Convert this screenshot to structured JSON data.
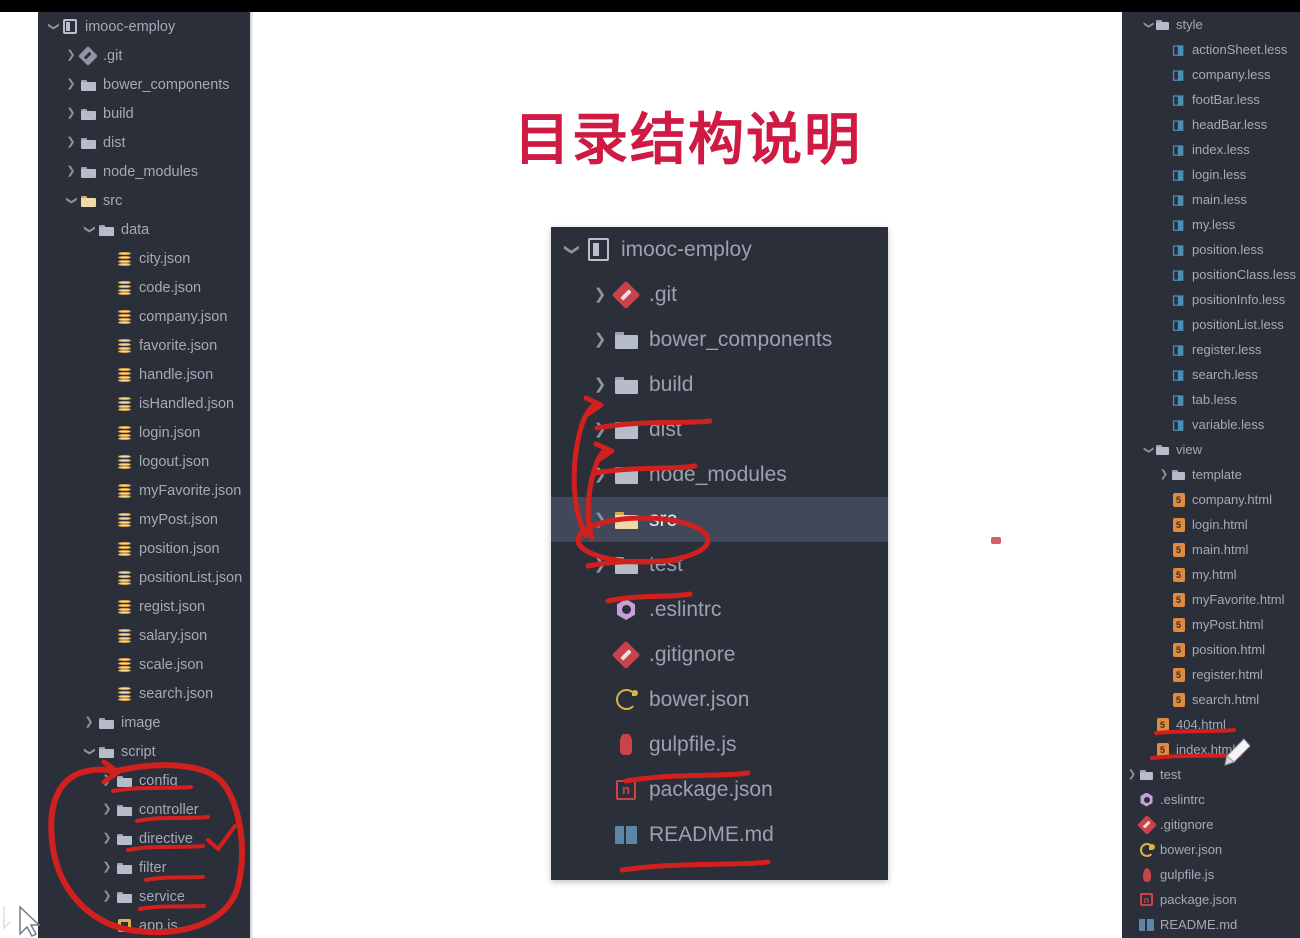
{
  "title": "目录结构说明",
  "colors": {
    "title_red": "#cf1b43",
    "annotation_red": "#d0211f",
    "panel_bg": "#2b2f3a",
    "selected_row": "#41485a",
    "text": "#a4aab5"
  },
  "left_tree": {
    "name": "project-file-tree-left",
    "items": [
      {
        "label": "imooc-employ",
        "indent": 0,
        "arrow": "down",
        "icon": "module-icon"
      },
      {
        "label": ".git",
        "indent": 1,
        "arrow": "right",
        "icon": "git-icon-grey"
      },
      {
        "label": "bower_components",
        "indent": 1,
        "arrow": "right",
        "icon": "folder-icon"
      },
      {
        "label": "build",
        "indent": 1,
        "arrow": "right",
        "icon": "folder-icon"
      },
      {
        "label": "dist",
        "indent": 1,
        "arrow": "right",
        "icon": "folder-icon"
      },
      {
        "label": "node_modules",
        "indent": 1,
        "arrow": "right",
        "icon": "folder-icon"
      },
      {
        "label": "src",
        "indent": 1,
        "arrow": "down",
        "icon": "folder-icon-gold"
      },
      {
        "label": "data",
        "indent": 2,
        "arrow": "down",
        "icon": "folder-icon"
      },
      {
        "label": "city.json",
        "indent": 3,
        "arrow": "none",
        "icon": "json-icon"
      },
      {
        "label": "code.json",
        "indent": 3,
        "arrow": "none",
        "icon": "json-icon"
      },
      {
        "label": "company.json",
        "indent": 3,
        "arrow": "none",
        "icon": "json-icon"
      },
      {
        "label": "favorite.json",
        "indent": 3,
        "arrow": "none",
        "icon": "json-icon"
      },
      {
        "label": "handle.json",
        "indent": 3,
        "arrow": "none",
        "icon": "json-icon"
      },
      {
        "label": "isHandled.json",
        "indent": 3,
        "arrow": "none",
        "icon": "json-icon"
      },
      {
        "label": "login.json",
        "indent": 3,
        "arrow": "none",
        "icon": "json-icon"
      },
      {
        "label": "logout.json",
        "indent": 3,
        "arrow": "none",
        "icon": "json-icon"
      },
      {
        "label": "myFavorite.json",
        "indent": 3,
        "arrow": "none",
        "icon": "json-icon"
      },
      {
        "label": "myPost.json",
        "indent": 3,
        "arrow": "none",
        "icon": "json-icon"
      },
      {
        "label": "position.json",
        "indent": 3,
        "arrow": "none",
        "icon": "json-icon"
      },
      {
        "label": "positionList.json",
        "indent": 3,
        "arrow": "none",
        "icon": "json-icon"
      },
      {
        "label": "regist.json",
        "indent": 3,
        "arrow": "none",
        "icon": "json-icon"
      },
      {
        "label": "salary.json",
        "indent": 3,
        "arrow": "none",
        "icon": "json-icon"
      },
      {
        "label": "scale.json",
        "indent": 3,
        "arrow": "none",
        "icon": "json-icon"
      },
      {
        "label": "search.json",
        "indent": 3,
        "arrow": "none",
        "icon": "json-icon"
      },
      {
        "label": "image",
        "indent": 2,
        "arrow": "right",
        "icon": "folder-icon"
      },
      {
        "label": "script",
        "indent": 2,
        "arrow": "down",
        "icon": "folder-icon"
      },
      {
        "label": "config",
        "indent": 3,
        "arrow": "right",
        "icon": "folder-icon"
      },
      {
        "label": "controller",
        "indent": 3,
        "arrow": "right",
        "icon": "folder-icon"
      },
      {
        "label": "directive",
        "indent": 3,
        "arrow": "right",
        "icon": "folder-icon"
      },
      {
        "label": "filter",
        "indent": 3,
        "arrow": "right",
        "icon": "folder-icon"
      },
      {
        "label": "service",
        "indent": 3,
        "arrow": "right",
        "icon": "folder-icon"
      },
      {
        "label": "app.js",
        "indent": 3,
        "arrow": "none",
        "icon": "appjs-icon"
      }
    ]
  },
  "center_tree": {
    "name": "project-file-tree-center",
    "items": [
      {
        "label": "imooc-employ",
        "indent": 0,
        "arrow": "down",
        "icon": "module-icon",
        "selected": false
      },
      {
        "label": ".git",
        "indent": 1,
        "arrow": "right",
        "icon": "git-icon",
        "selected": false
      },
      {
        "label": "bower_components",
        "indent": 1,
        "arrow": "right",
        "icon": "folder-icon",
        "selected": false
      },
      {
        "label": "build",
        "indent": 1,
        "arrow": "right",
        "icon": "folder-icon",
        "selected": false
      },
      {
        "label": "dist",
        "indent": 1,
        "arrow": "right",
        "icon": "folder-icon",
        "selected": false
      },
      {
        "label": "node_modules",
        "indent": 1,
        "arrow": "right",
        "icon": "folder-icon",
        "selected": false
      },
      {
        "label": "src",
        "indent": 1,
        "arrow": "right",
        "icon": "folder-icon-gold",
        "selected": true
      },
      {
        "label": "test",
        "indent": 1,
        "arrow": "right",
        "icon": "folder-icon",
        "selected": false
      },
      {
        "label": ".eslintrc",
        "indent": 1,
        "arrow": "none",
        "icon": "eslint-icon",
        "selected": false
      },
      {
        "label": ".gitignore",
        "indent": 1,
        "arrow": "none",
        "icon": "git-icon",
        "selected": false
      },
      {
        "label": "bower.json",
        "indent": 1,
        "arrow": "none",
        "icon": "bower-icon",
        "selected": false
      },
      {
        "label": "gulpfile.js",
        "indent": 1,
        "arrow": "none",
        "icon": "gulp-icon",
        "selected": false
      },
      {
        "label": "package.json",
        "indent": 1,
        "arrow": "none",
        "icon": "package-icon",
        "selected": false
      },
      {
        "label": "README.md",
        "indent": 1,
        "arrow": "none",
        "icon": "readme-icon",
        "selected": false
      }
    ]
  },
  "right_tree": {
    "name": "project-file-tree-right",
    "items": [
      {
        "label": "style",
        "indent": 1,
        "arrow": "down",
        "icon": "folder-icon"
      },
      {
        "label": "actionSheet.less",
        "indent": 2,
        "arrow": "none",
        "icon": "less-icon"
      },
      {
        "label": "company.less",
        "indent": 2,
        "arrow": "none",
        "icon": "less-icon"
      },
      {
        "label": "footBar.less",
        "indent": 2,
        "arrow": "none",
        "icon": "less-icon"
      },
      {
        "label": "headBar.less",
        "indent": 2,
        "arrow": "none",
        "icon": "less-icon"
      },
      {
        "label": "index.less",
        "indent": 2,
        "arrow": "none",
        "icon": "less-icon"
      },
      {
        "label": "login.less",
        "indent": 2,
        "arrow": "none",
        "icon": "less-icon"
      },
      {
        "label": "main.less",
        "indent": 2,
        "arrow": "none",
        "icon": "less-icon"
      },
      {
        "label": "my.less",
        "indent": 2,
        "arrow": "none",
        "icon": "less-icon"
      },
      {
        "label": "position.less",
        "indent": 2,
        "arrow": "none",
        "icon": "less-icon"
      },
      {
        "label": "positionClass.less",
        "indent": 2,
        "arrow": "none",
        "icon": "less-icon"
      },
      {
        "label": "positionInfo.less",
        "indent": 2,
        "arrow": "none",
        "icon": "less-icon"
      },
      {
        "label": "positionList.less",
        "indent": 2,
        "arrow": "none",
        "icon": "less-icon"
      },
      {
        "label": "register.less",
        "indent": 2,
        "arrow": "none",
        "icon": "less-icon"
      },
      {
        "label": "search.less",
        "indent": 2,
        "arrow": "none",
        "icon": "less-icon"
      },
      {
        "label": "tab.less",
        "indent": 2,
        "arrow": "none",
        "icon": "less-icon"
      },
      {
        "label": "variable.less",
        "indent": 2,
        "arrow": "none",
        "icon": "less-icon"
      },
      {
        "label": "view",
        "indent": 1,
        "arrow": "down",
        "icon": "folder-icon"
      },
      {
        "label": "template",
        "indent": 2,
        "arrow": "right",
        "icon": "folder-icon"
      },
      {
        "label": "company.html",
        "indent": 2,
        "arrow": "none",
        "icon": "html-icon"
      },
      {
        "label": "login.html",
        "indent": 2,
        "arrow": "none",
        "icon": "html-icon"
      },
      {
        "label": "main.html",
        "indent": 2,
        "arrow": "none",
        "icon": "html-icon"
      },
      {
        "label": "my.html",
        "indent": 2,
        "arrow": "none",
        "icon": "html-icon"
      },
      {
        "label": "myFavorite.html",
        "indent": 2,
        "arrow": "none",
        "icon": "html-icon"
      },
      {
        "label": "myPost.html",
        "indent": 2,
        "arrow": "none",
        "icon": "html-icon"
      },
      {
        "label": "position.html",
        "indent": 2,
        "arrow": "none",
        "icon": "html-icon"
      },
      {
        "label": "register.html",
        "indent": 2,
        "arrow": "none",
        "icon": "html-icon"
      },
      {
        "label": "search.html",
        "indent": 2,
        "arrow": "none",
        "icon": "html-icon"
      },
      {
        "label": "404.html",
        "indent": 1,
        "arrow": "none",
        "icon": "html-icon"
      },
      {
        "label": "index.html",
        "indent": 1,
        "arrow": "none",
        "icon": "html-icon"
      },
      {
        "label": "test",
        "indent": 0,
        "arrow": "right",
        "icon": "folder-icon"
      },
      {
        "label": ".eslintrc",
        "indent": 0,
        "arrow": "none",
        "icon": "eslint-icon"
      },
      {
        "label": ".gitignore",
        "indent": 0,
        "arrow": "none",
        "icon": "git-icon"
      },
      {
        "label": "bower.json",
        "indent": 0,
        "arrow": "none",
        "icon": "bower-icon"
      },
      {
        "label": "gulpfile.js",
        "indent": 0,
        "arrow": "none",
        "icon": "gulp-icon"
      },
      {
        "label": "package.json",
        "indent": 0,
        "arrow": "none",
        "icon": "package-icon"
      },
      {
        "label": "README.md",
        "indent": 0,
        "arrow": "none",
        "icon": "readme-icon"
      }
    ]
  },
  "annotations": {
    "name": "red-ink-annotations",
    "marks": [
      "circle-around-script-children",
      "underline-config",
      "underline-controller",
      "underline-directive",
      "checkmark-directive",
      "underline-filter",
      "underline-service",
      "arrow-src-to-build",
      "arrow-src-to-dist",
      "underline-build",
      "underline-dist",
      "circle-src",
      "underline-src",
      "underline-test",
      "underline-gulpfile",
      "underline-readme",
      "underline-404-html",
      "underline-index-html",
      "red-dot-mark"
    ]
  },
  "cursors": {
    "pen_cursor": "pen-cursor",
    "mouse_cursor": "mouse-pointer-cursor"
  }
}
